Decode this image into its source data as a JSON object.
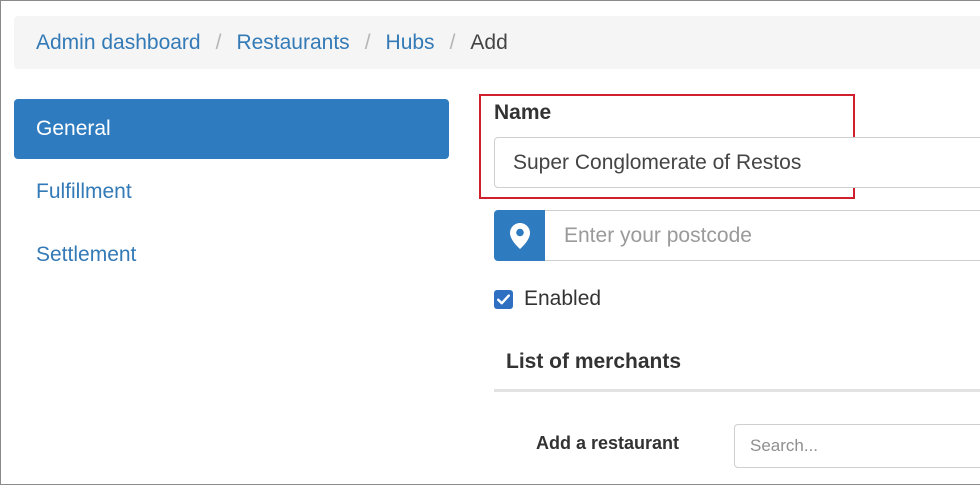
{
  "breadcrumb": {
    "items": [
      "Admin dashboard",
      "Restaurants",
      "Hubs"
    ],
    "separator": "/",
    "current": "Add"
  },
  "sidebar": {
    "items": [
      {
        "label": "General",
        "active": true
      },
      {
        "label": "Fulfillment",
        "active": false
      },
      {
        "label": "Settlement",
        "active": false
      }
    ]
  },
  "form": {
    "name_label": "Name",
    "name_value": "Super Conglomerate of Restos",
    "postcode_placeholder": "Enter your postcode",
    "postcode_icon": "map-pin-icon",
    "enabled_label": "Enabled",
    "enabled_checked": true,
    "merchants_title": "List of merchants",
    "add_restaurant_label": "Add a restaurant",
    "search_placeholder": "Search..."
  },
  "colors": {
    "accent": "#2f7bbf",
    "link": "#337ab7",
    "highlight": "#d0202e"
  }
}
